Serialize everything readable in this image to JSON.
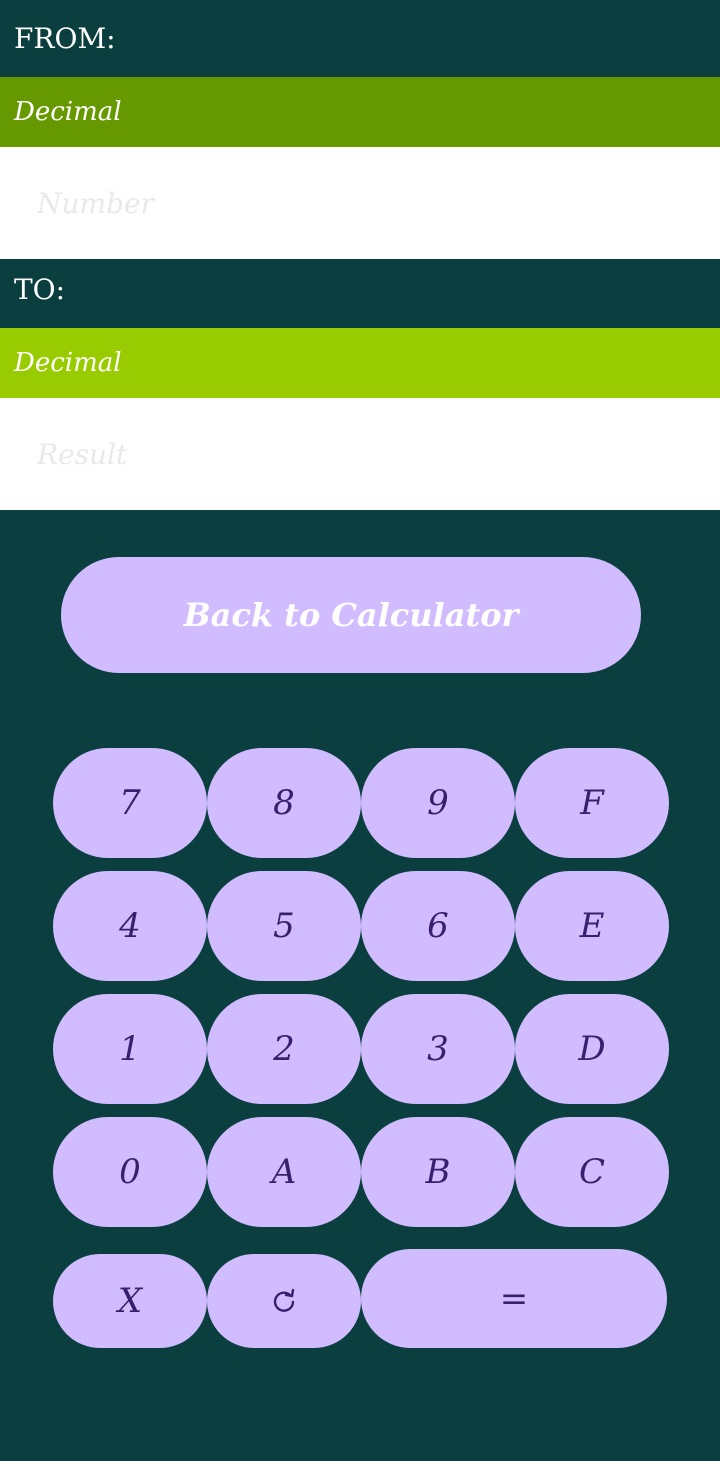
{
  "from": {
    "label": "FROM:",
    "base": "Decimal",
    "base_color": "#669900",
    "input_placeholder": "Number",
    "input_value": ""
  },
  "to": {
    "label": "TO:",
    "base": "Decimal",
    "base_color": "#99cc00",
    "input_placeholder": "Result",
    "input_value": ""
  },
  "back_button": {
    "label": "Back to Calculator"
  },
  "keypad": {
    "row1": [
      "7",
      "8",
      "9",
      "F"
    ],
    "row2": [
      "4",
      "5",
      "6",
      "E"
    ],
    "row3": [
      "1",
      "2",
      "3",
      "D"
    ],
    "row4": [
      "0",
      "A",
      "B",
      "C"
    ],
    "row5": {
      "clear": "X",
      "reset_icon": "refresh-icon",
      "equals": "="
    }
  },
  "colors": {
    "background": "#0b3f3f",
    "key_fill": "#d1bcff",
    "key_text": "#3a1f6e"
  }
}
